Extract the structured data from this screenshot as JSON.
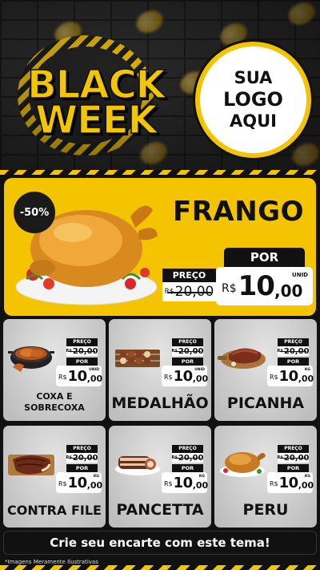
{
  "header": {
    "title_line1": "BLACK",
    "title_line2": "WEEK",
    "logo": [
      "SUA",
      "LOGO",
      "AQUI"
    ]
  },
  "featured": {
    "discount": "-50%",
    "name": "FRANGO",
    "old_label": "PREÇO",
    "old_currency": "R$",
    "old_price": "20,00",
    "new_label": "POR",
    "currency": "R$",
    "price_int": "10",
    "price_dec": ",00",
    "unit": "UNID"
  },
  "products": [
    {
      "name_line1": "COXA E",
      "name_line2": "SOBRECOXA",
      "old_label": "PREÇO",
      "old_currency": "R$",
      "old_price": "20,00",
      "new_label": "POR",
      "currency": "R$",
      "price_int": "10",
      "price_dec": ",00",
      "unit": "UNID"
    },
    {
      "name": "MEDALHÃO",
      "old_label": "PREÇO",
      "old_currency": "R$",
      "old_price": "20,00",
      "new_label": "POR",
      "currency": "R$",
      "price_int": "10",
      "price_dec": ",00",
      "unit": "UNID"
    },
    {
      "name": "PICANHA",
      "old_label": "PREÇO",
      "old_currency": "R$",
      "old_price": "20,00",
      "new_label": "POR",
      "currency": "R$",
      "price_int": "10",
      "price_dec": ",00",
      "unit": "KG"
    },
    {
      "name": "CONTRA FILE",
      "old_label": "PREÇO",
      "old_currency": "R$",
      "old_price": "20,00",
      "new_label": "POR",
      "currency": "R$",
      "price_int": "10",
      "price_dec": ",00",
      "unit": "KG"
    },
    {
      "name": "PANCETTA",
      "old_label": "PREÇO",
      "old_currency": "R$",
      "old_price": "20,00",
      "new_label": "POR",
      "currency": "R$",
      "price_int": "10",
      "price_dec": ",00",
      "unit": "KG"
    },
    {
      "name": "PERU",
      "old_label": "PREÇO",
      "old_currency": "R$",
      "old_price": "20,00",
      "new_label": "POR",
      "currency": "R$",
      "price_int": "10",
      "price_dec": ",00",
      "unit": "KG"
    }
  ],
  "footer": {
    "cta": "Crie seu encarte com este tema!",
    "disclaimer": "*Imagens Meramente Ilustrativas"
  },
  "colors": {
    "accent": "#f5c400",
    "dark": "#111111",
    "card": "#cfcfcf"
  }
}
